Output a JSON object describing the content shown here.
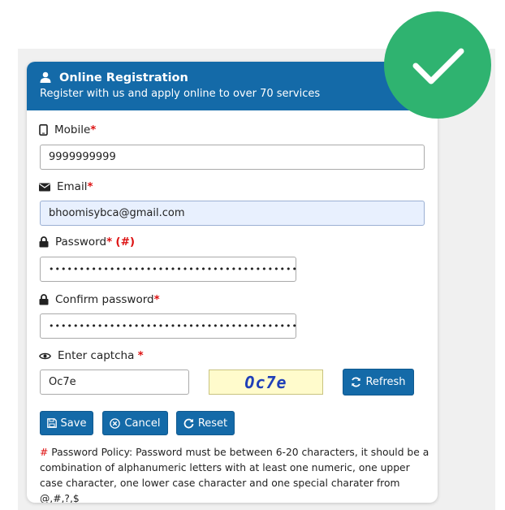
{
  "header": {
    "title": "Online Registration",
    "subtitle": "Register with us and apply online to over 70 services"
  },
  "mobile": {
    "label": "Mobile",
    "required_mark": "*",
    "value": "9999999999"
  },
  "email": {
    "label": "Email",
    "required_mark": "*",
    "value": "bhoomisybca@gmail.com"
  },
  "password": {
    "label": "Password",
    "required_mark": "*",
    "policy_mark": "(#)",
    "value": "•••••••••••••••••••••••••••••••••••••••••"
  },
  "confirm_password": {
    "label": "Confirm password",
    "required_mark": "*",
    "value": "•••••••••••••••••••••••••••••••••••••••••"
  },
  "captcha": {
    "label": "Enter captcha",
    "required_mark": "*",
    "value": "Oc7e",
    "image_text": "Oc7e",
    "refresh_label": "Refresh"
  },
  "buttons": {
    "save": "Save",
    "cancel": "Cancel",
    "reset": "Reset"
  },
  "policy": {
    "hash": "#",
    "text": " Password Policy: Password must be between 6-20 characters, it should be a combination of alphanumeric letters with at least one numeric, one upper case character, one lower case character and one special charater from @,#,?,$"
  },
  "colors": {
    "primary": "#146aa8",
    "success_badge": "#2fb370",
    "required": "#dd1111",
    "captcha_bg": "#fffbcc"
  },
  "icons": [
    "user-icon",
    "mobile-icon",
    "envelope-icon",
    "lock-icon",
    "eye-icon",
    "refresh-icon",
    "save-icon",
    "cancel-icon",
    "reset-icon",
    "checkmark-icon"
  ]
}
